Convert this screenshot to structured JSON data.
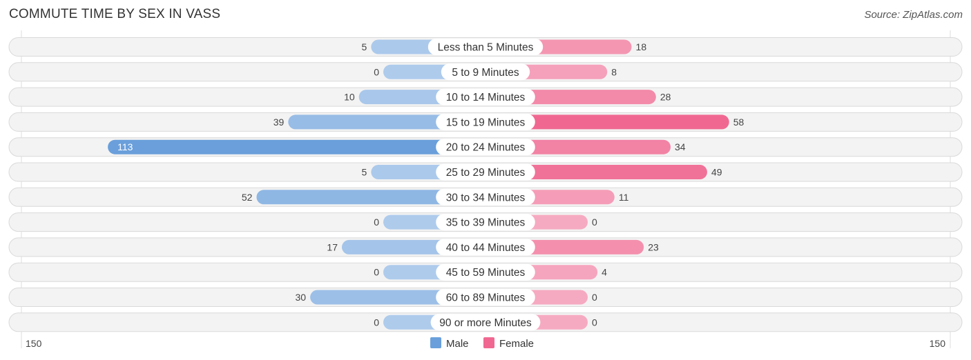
{
  "chart_data": {
    "type": "bar",
    "orientation": "horizontal-diverging",
    "title": "COMMUTE TIME BY SEX IN VASS",
    "source": "Source: ZipAtlas.com",
    "categories": [
      "Less than 5 Minutes",
      "5 to 9 Minutes",
      "10 to 14 Minutes",
      "15 to 19 Minutes",
      "20 to 24 Minutes",
      "25 to 29 Minutes",
      "30 to 34 Minutes",
      "35 to 39 Minutes",
      "40 to 44 Minutes",
      "45 to 59 Minutes",
      "60 to 89 Minutes",
      "90 or more Minutes"
    ],
    "series": [
      {
        "name": "Male",
        "color": "#6a9fdb",
        "values": [
          5,
          0,
          10,
          39,
          113,
          5,
          52,
          0,
          17,
          0,
          30,
          0
        ]
      },
      {
        "name": "Female",
        "color": "#f06892",
        "values": [
          18,
          8,
          28,
          58,
          34,
          49,
          11,
          0,
          23,
          4,
          0,
          0
        ]
      }
    ],
    "axis": {
      "left_label": "150",
      "right_label": "150",
      "max": 150
    },
    "legend": {
      "position": "bottom-center",
      "items": [
        "Male",
        "Female"
      ]
    }
  }
}
